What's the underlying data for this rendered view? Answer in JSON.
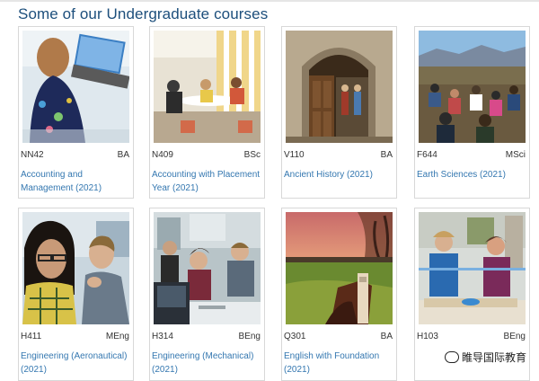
{
  "heading": "Some of our Undergraduate courses",
  "courses": [
    {
      "code": "NN42",
      "level": "BA",
      "title": "Accounting and Management (2021)"
    },
    {
      "code": "N409",
      "level": "BSc",
      "title": "Accounting with Placement Year (2021)"
    },
    {
      "code": "V110",
      "level": "BA",
      "title": "Ancient History (2021)"
    },
    {
      "code": "F644",
      "level": "MSci",
      "title": "Earth Sciences (2021)"
    },
    {
      "code": "H411",
      "level": "MEng",
      "title": "Engineering (Aeronautical) (2021)"
    },
    {
      "code": "H314",
      "level": "BEng",
      "title": "Engineering (Mechanical) (2021)"
    },
    {
      "code": "Q301",
      "level": "BA",
      "title": "English with Foundation (2021)"
    },
    {
      "code": "H103",
      "level": "BEng",
      "title": ""
    }
  ],
  "watermark": "睢导国际教育",
  "colors": {
    "heading": "#1d4f7c",
    "link": "#3477b0",
    "card_border": "#d8d8d8"
  }
}
